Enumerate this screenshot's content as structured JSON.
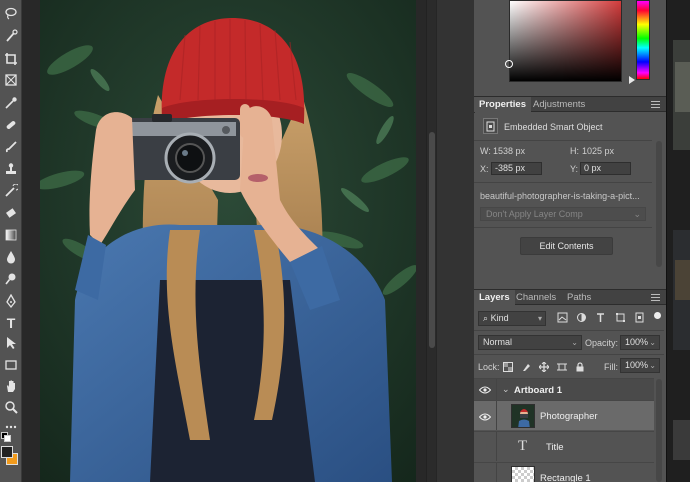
{
  "colors": {
    "app_bg": "#282828",
    "panel_bg": "#535353",
    "foreground_swatch": "#222222",
    "background_swatch": "#f19b1d",
    "accent_red": "#d33c3c"
  },
  "toolbar": {
    "tools": [
      {
        "name": "lasso-tool-icon"
      },
      {
        "name": "quick-selection-tool-icon"
      },
      {
        "name": "crop-tool-icon"
      },
      {
        "name": "frame-tool-icon"
      },
      {
        "name": "eyedropper-tool-icon"
      },
      {
        "name": "healing-brush-tool-icon"
      },
      {
        "name": "brush-tool-icon"
      },
      {
        "name": "clone-stamp-tool-icon"
      },
      {
        "name": "history-brush-tool-icon"
      },
      {
        "name": "eraser-tool-icon"
      },
      {
        "name": "gradient-tool-icon"
      },
      {
        "name": "blur-tool-icon"
      },
      {
        "name": "dodge-tool-icon"
      },
      {
        "name": "pen-tool-icon"
      },
      {
        "name": "type-tool-icon"
      },
      {
        "name": "path-selection-tool-icon"
      },
      {
        "name": "rectangle-tool-icon"
      },
      {
        "name": "hand-tool-icon"
      },
      {
        "name": "zoom-tool-icon"
      },
      {
        "name": "more-tools-icon"
      }
    ],
    "type_tool_glyph": "T"
  },
  "properties_panel": {
    "tabs": [
      {
        "label": "Properties"
      },
      {
        "label": "Adjustments"
      }
    ],
    "object_type": "Embedded Smart Object",
    "w_label": "W:",
    "w_value": "1538 px",
    "h_label": "H:",
    "h_value": "1025 px",
    "x_label": "X:",
    "x_value": "-385 px",
    "y_label": "Y:",
    "y_value": "0 px",
    "filename": "beautiful-photographer-is-taking-a-pict...",
    "layer_comp": "Don't Apply Layer Comp",
    "edit_button": "Edit Contents"
  },
  "layers_panel": {
    "tabs": [
      {
        "label": "Layers"
      },
      {
        "label": "Channels"
      },
      {
        "label": "Paths"
      }
    ],
    "filter_kind": "Kind",
    "blend_mode": "Normal",
    "opacity_label": "Opacity:",
    "opacity_value": "100%",
    "lock_label": "Lock:",
    "fill_label": "Fill:",
    "fill_value": "100%",
    "layers": [
      {
        "name": "Artboard 1",
        "kind": "artboard",
        "visible": true
      },
      {
        "name": "Photographer",
        "kind": "smart-object",
        "visible": true,
        "selected": true
      },
      {
        "name": "Title",
        "kind": "text",
        "visible": false,
        "glyph": "T"
      },
      {
        "name": "Rectangle 1",
        "kind": "shape",
        "visible": false
      }
    ]
  }
}
